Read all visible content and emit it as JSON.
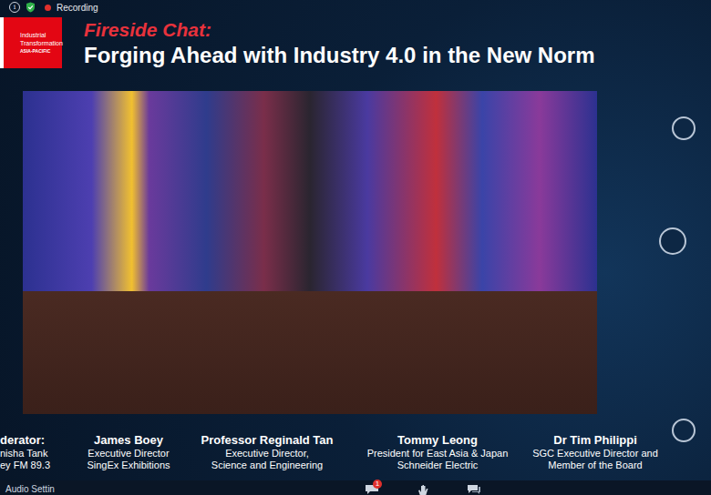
{
  "top_bar": {
    "info_icon": "i",
    "recording": "Recording"
  },
  "logo": {
    "lines": [
      "Industrial",
      "Transformation",
      "ASIA-PACIFIC"
    ]
  },
  "header": {
    "kicker": "Fireside Chat:",
    "title": "Forging Ahead with Industry 4.0 in the New Norm"
  },
  "speakers": [
    {
      "name": "derator:",
      "lines": [
        "nisha Tank",
        "ey FM 89.3"
      ],
      "cut": true
    },
    {
      "name": "James Boey",
      "lines": [
        "Executive Director",
        "SingEx Exhibitions"
      ],
      "cut": false
    },
    {
      "name": "Professor Reginald Tan",
      "lines": [
        "Executive Director,",
        "Science and Engineering"
      ],
      "cut": false
    },
    {
      "name": "Tommy Leong",
      "lines": [
        "President for East Asia & Japan",
        "Schneider Electric"
      ],
      "cut": false
    },
    {
      "name": "Dr Tim Philippi",
      "lines": [
        "SGC Executive Director and",
        "Member of the Board"
      ],
      "cut": false
    }
  ],
  "toolbar": {
    "audio_label": "Audio Settin",
    "badge": "1"
  }
}
